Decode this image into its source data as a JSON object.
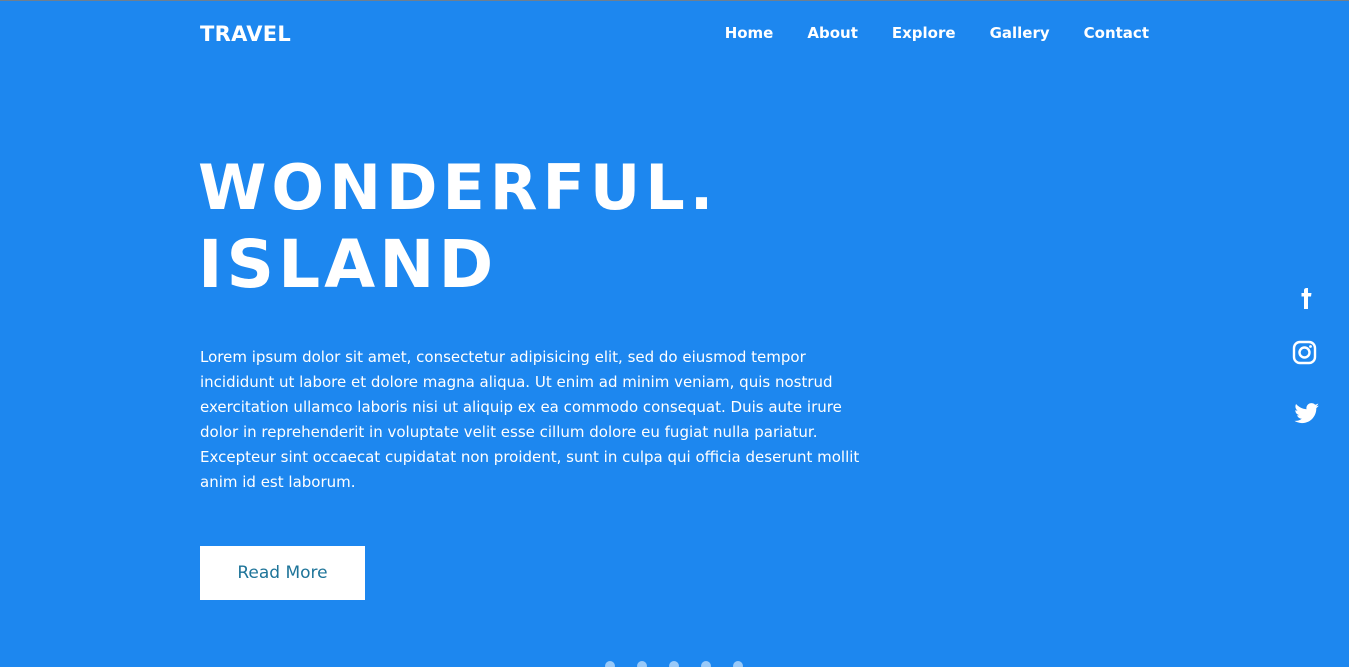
{
  "header": {
    "brand": "TRAVEL",
    "nav": [
      {
        "label": "Home"
      },
      {
        "label": "About"
      },
      {
        "label": "Explore"
      },
      {
        "label": "Gallery"
      },
      {
        "label": "Contact"
      }
    ]
  },
  "hero": {
    "title_line1": "WONDERFUL.",
    "title_line2": "ISLAND",
    "description": "Lorem ipsum dolor sit amet, consectetur adipisicing elit, sed do eiusmod tempor incididunt ut labore et dolore magna aliqua. Ut enim ad minim veniam, quis nostrud exercitation ullamco laboris nisi ut aliquip ex ea commodo consequat. Duis aute irure dolor in reprehenderit in voluptate velit esse cillum dolore eu fugiat nulla pariatur. Excepteur sint occaecat cupidatat non proident, sunt in culpa qui officia deserunt mollit anim id est laborum.",
    "read_more_label": "Read More"
  },
  "social": [
    {
      "icon": "facebook-icon"
    },
    {
      "icon": "instagram-icon"
    },
    {
      "icon": "twitter-icon"
    }
  ],
  "colors": {
    "background": "#1d87ef",
    "text": "#ffffff",
    "button_text": "#1e7499",
    "button_bg": "#ffffff"
  }
}
